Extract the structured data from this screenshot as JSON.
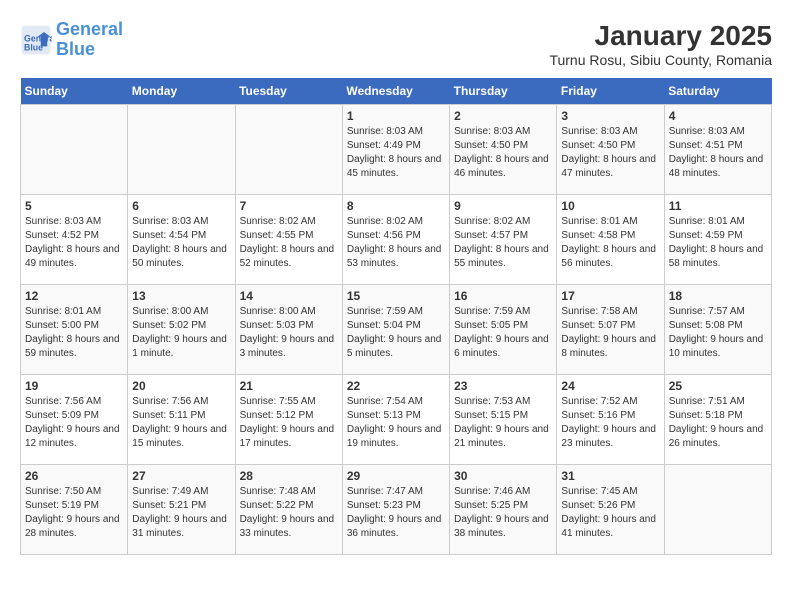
{
  "logo": {
    "line1": "General",
    "line2": "Blue"
  },
  "title": "January 2025",
  "subtitle": "Turnu Rosu, Sibiu County, Romania",
  "headers": [
    "Sunday",
    "Monday",
    "Tuesday",
    "Wednesday",
    "Thursday",
    "Friday",
    "Saturday"
  ],
  "weeks": [
    [
      {
        "num": "",
        "info": ""
      },
      {
        "num": "",
        "info": ""
      },
      {
        "num": "",
        "info": ""
      },
      {
        "num": "1",
        "info": "Sunrise: 8:03 AM\nSunset: 4:49 PM\nDaylight: 8 hours and 45 minutes."
      },
      {
        "num": "2",
        "info": "Sunrise: 8:03 AM\nSunset: 4:50 PM\nDaylight: 8 hours and 46 minutes."
      },
      {
        "num": "3",
        "info": "Sunrise: 8:03 AM\nSunset: 4:50 PM\nDaylight: 8 hours and 47 minutes."
      },
      {
        "num": "4",
        "info": "Sunrise: 8:03 AM\nSunset: 4:51 PM\nDaylight: 8 hours and 48 minutes."
      }
    ],
    [
      {
        "num": "5",
        "info": "Sunrise: 8:03 AM\nSunset: 4:52 PM\nDaylight: 8 hours and 49 minutes."
      },
      {
        "num": "6",
        "info": "Sunrise: 8:03 AM\nSunset: 4:54 PM\nDaylight: 8 hours and 50 minutes."
      },
      {
        "num": "7",
        "info": "Sunrise: 8:02 AM\nSunset: 4:55 PM\nDaylight: 8 hours and 52 minutes."
      },
      {
        "num": "8",
        "info": "Sunrise: 8:02 AM\nSunset: 4:56 PM\nDaylight: 8 hours and 53 minutes."
      },
      {
        "num": "9",
        "info": "Sunrise: 8:02 AM\nSunset: 4:57 PM\nDaylight: 8 hours and 55 minutes."
      },
      {
        "num": "10",
        "info": "Sunrise: 8:01 AM\nSunset: 4:58 PM\nDaylight: 8 hours and 56 minutes."
      },
      {
        "num": "11",
        "info": "Sunrise: 8:01 AM\nSunset: 4:59 PM\nDaylight: 8 hours and 58 minutes."
      }
    ],
    [
      {
        "num": "12",
        "info": "Sunrise: 8:01 AM\nSunset: 5:00 PM\nDaylight: 8 hours and 59 minutes."
      },
      {
        "num": "13",
        "info": "Sunrise: 8:00 AM\nSunset: 5:02 PM\nDaylight: 9 hours and 1 minute."
      },
      {
        "num": "14",
        "info": "Sunrise: 8:00 AM\nSunset: 5:03 PM\nDaylight: 9 hours and 3 minutes."
      },
      {
        "num": "15",
        "info": "Sunrise: 7:59 AM\nSunset: 5:04 PM\nDaylight: 9 hours and 5 minutes."
      },
      {
        "num": "16",
        "info": "Sunrise: 7:59 AM\nSunset: 5:05 PM\nDaylight: 9 hours and 6 minutes."
      },
      {
        "num": "17",
        "info": "Sunrise: 7:58 AM\nSunset: 5:07 PM\nDaylight: 9 hours and 8 minutes."
      },
      {
        "num": "18",
        "info": "Sunrise: 7:57 AM\nSunset: 5:08 PM\nDaylight: 9 hours and 10 minutes."
      }
    ],
    [
      {
        "num": "19",
        "info": "Sunrise: 7:56 AM\nSunset: 5:09 PM\nDaylight: 9 hours and 12 minutes."
      },
      {
        "num": "20",
        "info": "Sunrise: 7:56 AM\nSunset: 5:11 PM\nDaylight: 9 hours and 15 minutes."
      },
      {
        "num": "21",
        "info": "Sunrise: 7:55 AM\nSunset: 5:12 PM\nDaylight: 9 hours and 17 minutes."
      },
      {
        "num": "22",
        "info": "Sunrise: 7:54 AM\nSunset: 5:13 PM\nDaylight: 9 hours and 19 minutes."
      },
      {
        "num": "23",
        "info": "Sunrise: 7:53 AM\nSunset: 5:15 PM\nDaylight: 9 hours and 21 minutes."
      },
      {
        "num": "24",
        "info": "Sunrise: 7:52 AM\nSunset: 5:16 PM\nDaylight: 9 hours and 23 minutes."
      },
      {
        "num": "25",
        "info": "Sunrise: 7:51 AM\nSunset: 5:18 PM\nDaylight: 9 hours and 26 minutes."
      }
    ],
    [
      {
        "num": "26",
        "info": "Sunrise: 7:50 AM\nSunset: 5:19 PM\nDaylight: 9 hours and 28 minutes."
      },
      {
        "num": "27",
        "info": "Sunrise: 7:49 AM\nSunset: 5:21 PM\nDaylight: 9 hours and 31 minutes."
      },
      {
        "num": "28",
        "info": "Sunrise: 7:48 AM\nSunset: 5:22 PM\nDaylight: 9 hours and 33 minutes."
      },
      {
        "num": "29",
        "info": "Sunrise: 7:47 AM\nSunset: 5:23 PM\nDaylight: 9 hours and 36 minutes."
      },
      {
        "num": "30",
        "info": "Sunrise: 7:46 AM\nSunset: 5:25 PM\nDaylight: 9 hours and 38 minutes."
      },
      {
        "num": "31",
        "info": "Sunrise: 7:45 AM\nSunset: 5:26 PM\nDaylight: 9 hours and 41 minutes."
      },
      {
        "num": "",
        "info": ""
      }
    ]
  ]
}
